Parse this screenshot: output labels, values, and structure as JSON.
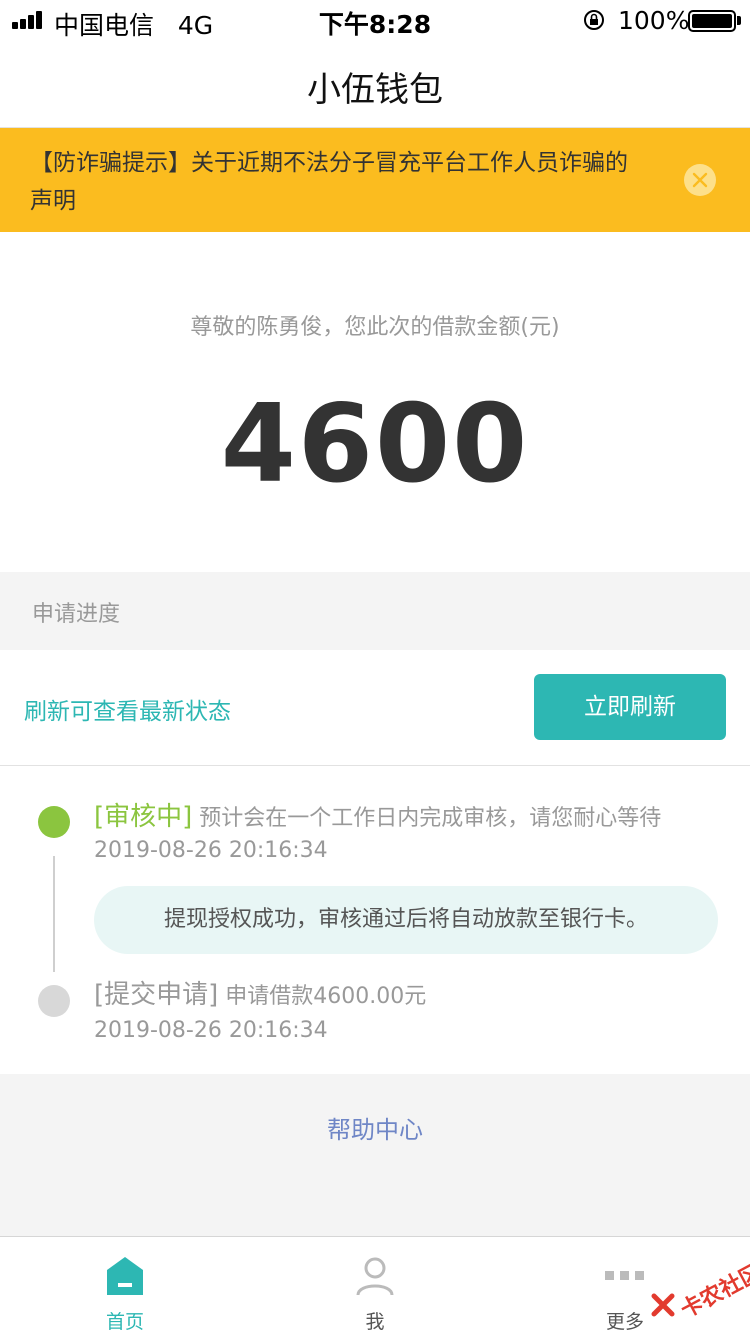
{
  "status_bar": {
    "carrier": "中国电信",
    "network": "4G",
    "time": "下午8:28",
    "battery": "100%"
  },
  "header": {
    "title": "小伍钱包"
  },
  "notice": {
    "text": "【防诈骗提示】关于近期不法分子冒充平台工作人员诈骗的声明"
  },
  "loan": {
    "greeting": "尊敬的陈勇俊，您此次的借款金额(元)",
    "amount": "4600"
  },
  "progress": {
    "section_label": "申请进度",
    "refresh_hint": "刷新可查看最新状态",
    "refresh_button": "立即刷新",
    "steps": [
      {
        "status": "[审核中]",
        "description": "预计会在一个工作日内完成审核，请您耐心等待",
        "time": "2019-08-26 20:16:34",
        "note": "提现授权成功，审核通过后将自动放款至银行卡。"
      },
      {
        "status": "[提交申请]",
        "description": "申请借款4600.00元",
        "time": "2019-08-26 20:16:34"
      }
    ]
  },
  "help": {
    "label": "帮助中心"
  },
  "tabs": [
    {
      "label": "首页",
      "icon": "home-icon"
    },
    {
      "label": "我",
      "icon": "user-icon"
    },
    {
      "label": "更多",
      "icon": "more-icon"
    }
  ],
  "watermark": {
    "text": "卡农社区"
  },
  "colors": {
    "accent": "#2db7b3",
    "notice_bg": "#fbbc1f",
    "active_status": "#8bc53f",
    "help_link": "#6f86c6"
  }
}
